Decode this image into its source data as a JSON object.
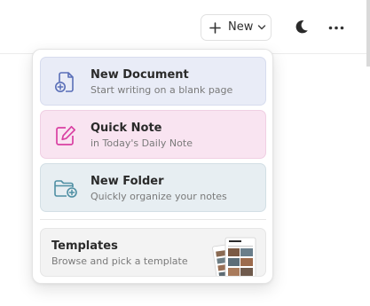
{
  "toolbar": {
    "new_label": "New",
    "new_icon": "plus-icon",
    "new_chevron_icon": "chevron-down-icon",
    "theme_icon": "moon-icon",
    "more_icon": "more-horizontal-icon"
  },
  "menu": {
    "items": [
      {
        "title": "New Document",
        "subtitle": "Start writing on a blank page",
        "icon": "document-plus-icon",
        "accent": "#5a6fb8",
        "background": "#e9ecf7"
      },
      {
        "title": "Quick Note",
        "subtitle": "in Today's Daily Note",
        "icon": "edit-note-icon",
        "accent": "#d93fa2",
        "background": "#f9e4f1"
      },
      {
        "title": "New Folder",
        "subtitle": "Quickly organize your notes",
        "icon": "folder-plus-icon",
        "accent": "#4f8fa3",
        "background": "#e7eef2"
      }
    ],
    "templates": {
      "title": "Templates",
      "subtitle": "Browse and pick a template",
      "preview": "templates-preview-image"
    }
  }
}
